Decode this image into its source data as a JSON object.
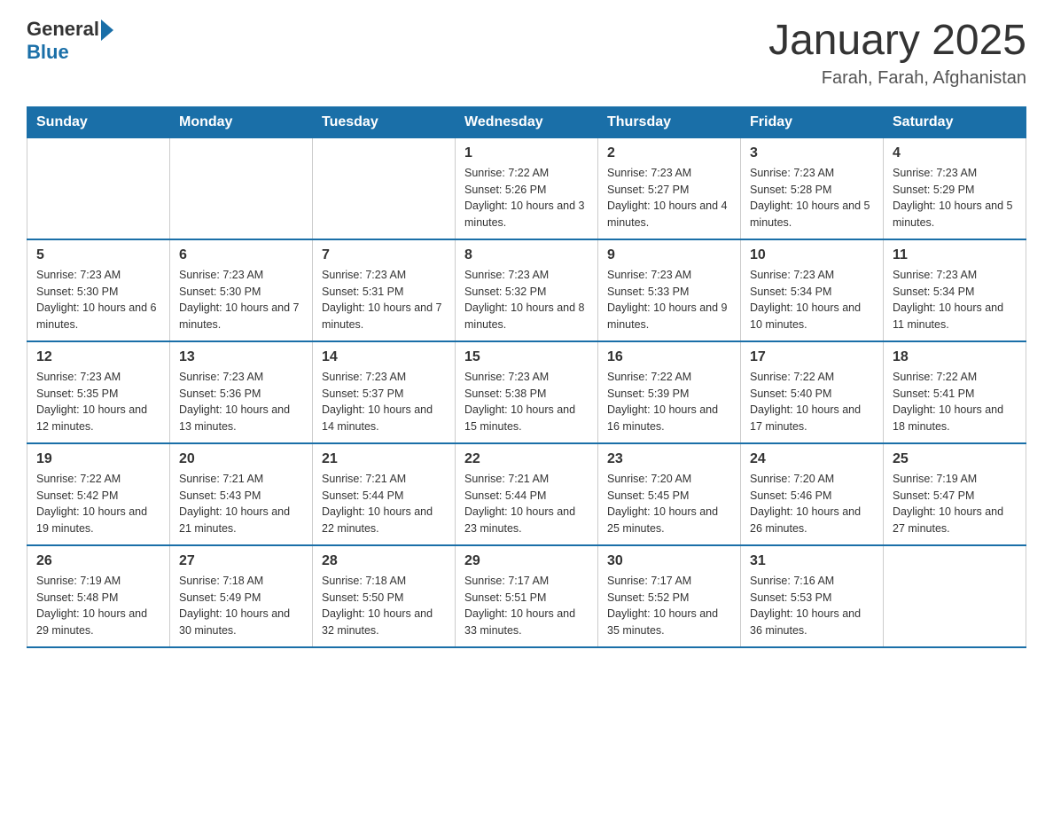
{
  "header": {
    "logo_general": "General",
    "logo_blue": "Blue",
    "title": "January 2025",
    "subtitle": "Farah, Farah, Afghanistan"
  },
  "days_of_week": [
    "Sunday",
    "Monday",
    "Tuesday",
    "Wednesday",
    "Thursday",
    "Friday",
    "Saturday"
  ],
  "weeks": [
    {
      "days": [
        {
          "num": "",
          "info": ""
        },
        {
          "num": "",
          "info": ""
        },
        {
          "num": "",
          "info": ""
        },
        {
          "num": "1",
          "info": "Sunrise: 7:22 AM\nSunset: 5:26 PM\nDaylight: 10 hours and 3 minutes."
        },
        {
          "num": "2",
          "info": "Sunrise: 7:23 AM\nSunset: 5:27 PM\nDaylight: 10 hours and 4 minutes."
        },
        {
          "num": "3",
          "info": "Sunrise: 7:23 AM\nSunset: 5:28 PM\nDaylight: 10 hours and 5 minutes."
        },
        {
          "num": "4",
          "info": "Sunrise: 7:23 AM\nSunset: 5:29 PM\nDaylight: 10 hours and 5 minutes."
        }
      ]
    },
    {
      "days": [
        {
          "num": "5",
          "info": "Sunrise: 7:23 AM\nSunset: 5:30 PM\nDaylight: 10 hours and 6 minutes."
        },
        {
          "num": "6",
          "info": "Sunrise: 7:23 AM\nSunset: 5:30 PM\nDaylight: 10 hours and 7 minutes."
        },
        {
          "num": "7",
          "info": "Sunrise: 7:23 AM\nSunset: 5:31 PM\nDaylight: 10 hours and 7 minutes."
        },
        {
          "num": "8",
          "info": "Sunrise: 7:23 AM\nSunset: 5:32 PM\nDaylight: 10 hours and 8 minutes."
        },
        {
          "num": "9",
          "info": "Sunrise: 7:23 AM\nSunset: 5:33 PM\nDaylight: 10 hours and 9 minutes."
        },
        {
          "num": "10",
          "info": "Sunrise: 7:23 AM\nSunset: 5:34 PM\nDaylight: 10 hours and 10 minutes."
        },
        {
          "num": "11",
          "info": "Sunrise: 7:23 AM\nSunset: 5:34 PM\nDaylight: 10 hours and 11 minutes."
        }
      ]
    },
    {
      "days": [
        {
          "num": "12",
          "info": "Sunrise: 7:23 AM\nSunset: 5:35 PM\nDaylight: 10 hours and 12 minutes."
        },
        {
          "num": "13",
          "info": "Sunrise: 7:23 AM\nSunset: 5:36 PM\nDaylight: 10 hours and 13 minutes."
        },
        {
          "num": "14",
          "info": "Sunrise: 7:23 AM\nSunset: 5:37 PM\nDaylight: 10 hours and 14 minutes."
        },
        {
          "num": "15",
          "info": "Sunrise: 7:23 AM\nSunset: 5:38 PM\nDaylight: 10 hours and 15 minutes."
        },
        {
          "num": "16",
          "info": "Sunrise: 7:22 AM\nSunset: 5:39 PM\nDaylight: 10 hours and 16 minutes."
        },
        {
          "num": "17",
          "info": "Sunrise: 7:22 AM\nSunset: 5:40 PM\nDaylight: 10 hours and 17 minutes."
        },
        {
          "num": "18",
          "info": "Sunrise: 7:22 AM\nSunset: 5:41 PM\nDaylight: 10 hours and 18 minutes."
        }
      ]
    },
    {
      "days": [
        {
          "num": "19",
          "info": "Sunrise: 7:22 AM\nSunset: 5:42 PM\nDaylight: 10 hours and 19 minutes."
        },
        {
          "num": "20",
          "info": "Sunrise: 7:21 AM\nSunset: 5:43 PM\nDaylight: 10 hours and 21 minutes."
        },
        {
          "num": "21",
          "info": "Sunrise: 7:21 AM\nSunset: 5:44 PM\nDaylight: 10 hours and 22 minutes."
        },
        {
          "num": "22",
          "info": "Sunrise: 7:21 AM\nSunset: 5:44 PM\nDaylight: 10 hours and 23 minutes."
        },
        {
          "num": "23",
          "info": "Sunrise: 7:20 AM\nSunset: 5:45 PM\nDaylight: 10 hours and 25 minutes."
        },
        {
          "num": "24",
          "info": "Sunrise: 7:20 AM\nSunset: 5:46 PM\nDaylight: 10 hours and 26 minutes."
        },
        {
          "num": "25",
          "info": "Sunrise: 7:19 AM\nSunset: 5:47 PM\nDaylight: 10 hours and 27 minutes."
        }
      ]
    },
    {
      "days": [
        {
          "num": "26",
          "info": "Sunrise: 7:19 AM\nSunset: 5:48 PM\nDaylight: 10 hours and 29 minutes."
        },
        {
          "num": "27",
          "info": "Sunrise: 7:18 AM\nSunset: 5:49 PM\nDaylight: 10 hours and 30 minutes."
        },
        {
          "num": "28",
          "info": "Sunrise: 7:18 AM\nSunset: 5:50 PM\nDaylight: 10 hours and 32 minutes."
        },
        {
          "num": "29",
          "info": "Sunrise: 7:17 AM\nSunset: 5:51 PM\nDaylight: 10 hours and 33 minutes."
        },
        {
          "num": "30",
          "info": "Sunrise: 7:17 AM\nSunset: 5:52 PM\nDaylight: 10 hours and 35 minutes."
        },
        {
          "num": "31",
          "info": "Sunrise: 7:16 AM\nSunset: 5:53 PM\nDaylight: 10 hours and 36 minutes."
        },
        {
          "num": "",
          "info": ""
        }
      ]
    }
  ]
}
